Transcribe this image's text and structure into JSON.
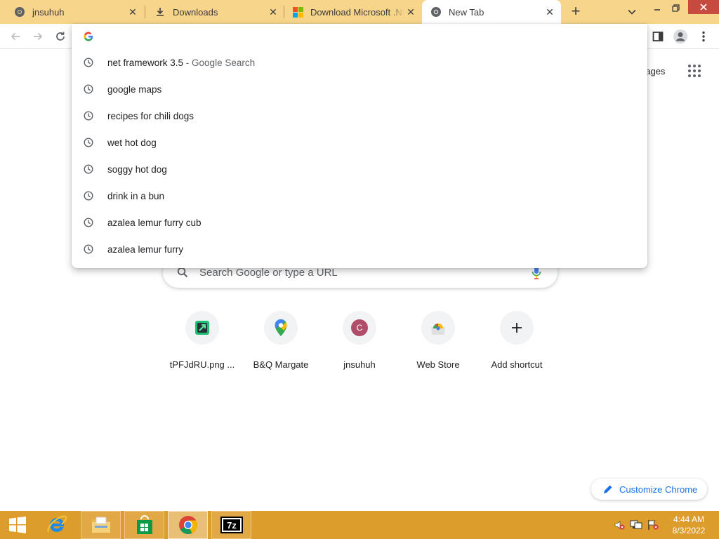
{
  "tabs": [
    {
      "title": "jnsuhuh",
      "icon": "chrome-icon"
    },
    {
      "title": "Downloads",
      "icon": "download-icon"
    },
    {
      "title": "Download Microsoft .NET",
      "icon": "microsoft-logo-icon"
    },
    {
      "title": "New Tab",
      "icon": "chrome-icon",
      "active": true
    }
  ],
  "tab_close_glyph": "✕",
  "new_tab_glyph": "+",
  "omnibox": {
    "value": "",
    "suggestions": [
      {
        "text": "net framework 3.5",
        "sub": " - Google Search"
      },
      {
        "text": "google maps",
        "sub": ""
      },
      {
        "text": "recipes for chili dogs",
        "sub": ""
      },
      {
        "text": "wet hot dog",
        "sub": ""
      },
      {
        "text": "soggy hot dog",
        "sub": ""
      },
      {
        "text": "drink in a bun",
        "sub": ""
      },
      {
        "text": "azalea lemur furry cub",
        "sub": ""
      },
      {
        "text": "azalea lemur furry",
        "sub": ""
      }
    ]
  },
  "ntp": {
    "images_link": "nages",
    "search_placeholder": "Search Google or type a URL",
    "shortcuts": [
      {
        "label": "tPFJdRU.png ...",
        "icon": "image-file-icon"
      },
      {
        "label": "B&Q Margate",
        "icon": "maps-pin-icon"
      },
      {
        "label": "jnsuhuh",
        "icon": "letter-avatar-icon",
        "letter": "C"
      },
      {
        "label": "Web Store",
        "icon": "web-store-icon"
      },
      {
        "label": "Add shortcut",
        "icon": "plus-icon"
      }
    ],
    "customize_label": "Customize Chrome"
  },
  "taskbar": {
    "time": "4:44 AM",
    "date": "8/3/2022"
  },
  "colors": {
    "tabstrip": "#f7d58b",
    "taskbar": "#dd9d2c",
    "accent": "#1a73e8"
  }
}
